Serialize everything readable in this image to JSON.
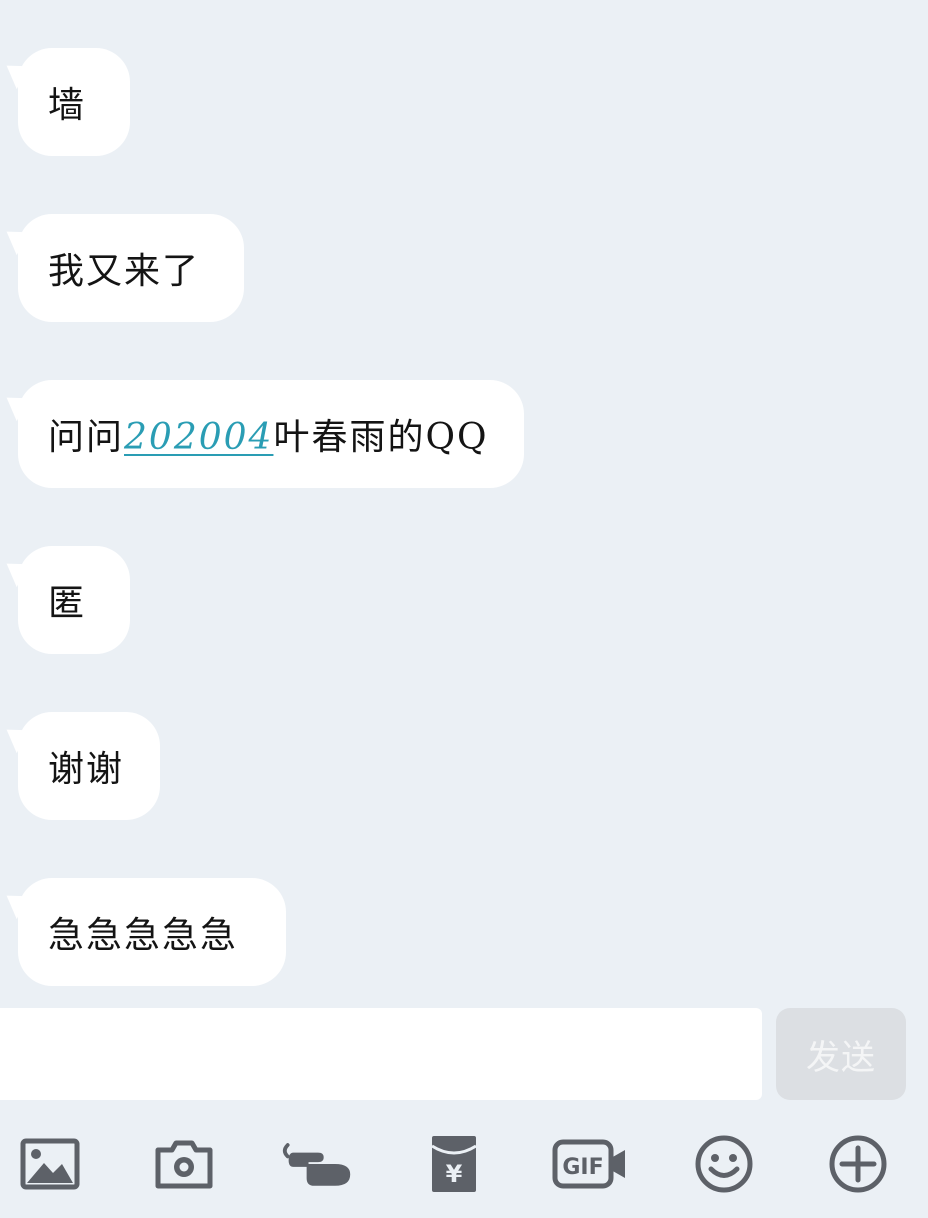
{
  "messages": [
    {
      "text": "墙"
    },
    {
      "text": "我又来了"
    },
    {
      "prefix": "问问",
      "link": "202004",
      "suffix": "叶春雨的QQ"
    },
    {
      "text": "匿"
    },
    {
      "text": "谢谢"
    },
    {
      "text": "急急急急急"
    }
  ],
  "composer": {
    "input_value": "",
    "send_label": "发送"
  },
  "toolbar": {
    "icons": [
      "image-icon",
      "camera-icon",
      "poke-icon",
      "red-packet-icon",
      "gif-icon",
      "emoji-icon",
      "add-icon"
    ],
    "gif_label": "GIF",
    "red_packet_symbol": "¥"
  },
  "colors": {
    "background": "#ebf0f5",
    "bubble": "#ffffff",
    "link": "#2a9db4",
    "icon": "#5d6168",
    "send_disabled": "#dcdfe3"
  }
}
